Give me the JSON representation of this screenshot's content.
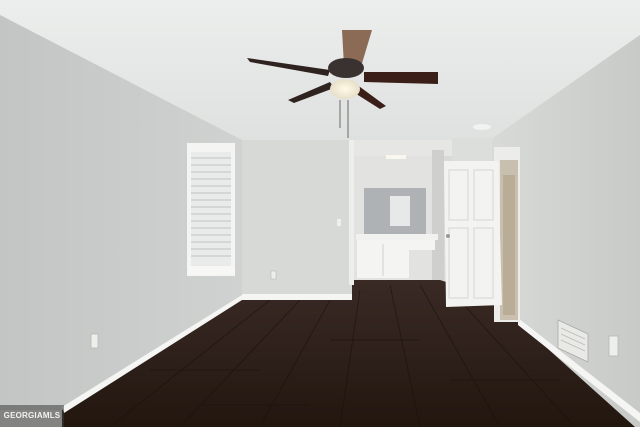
{
  "watermark": {
    "text": "GEORGIAMLS"
  },
  "colors": {
    "ceiling": "#e9ebea",
    "wall_left": "#c9cbca",
    "wall_back": "#d6d8d6",
    "wall_right": "#d1d3d1",
    "floor": "#2c1e1a",
    "baseboard": "#f4f4f2",
    "fan_blade": "#3a1f19",
    "door": "#f2f2f0"
  },
  "icons": [
    "ceiling-fan-icon",
    "window-icon",
    "door-icon",
    "outlet-icon",
    "vent-icon"
  ]
}
